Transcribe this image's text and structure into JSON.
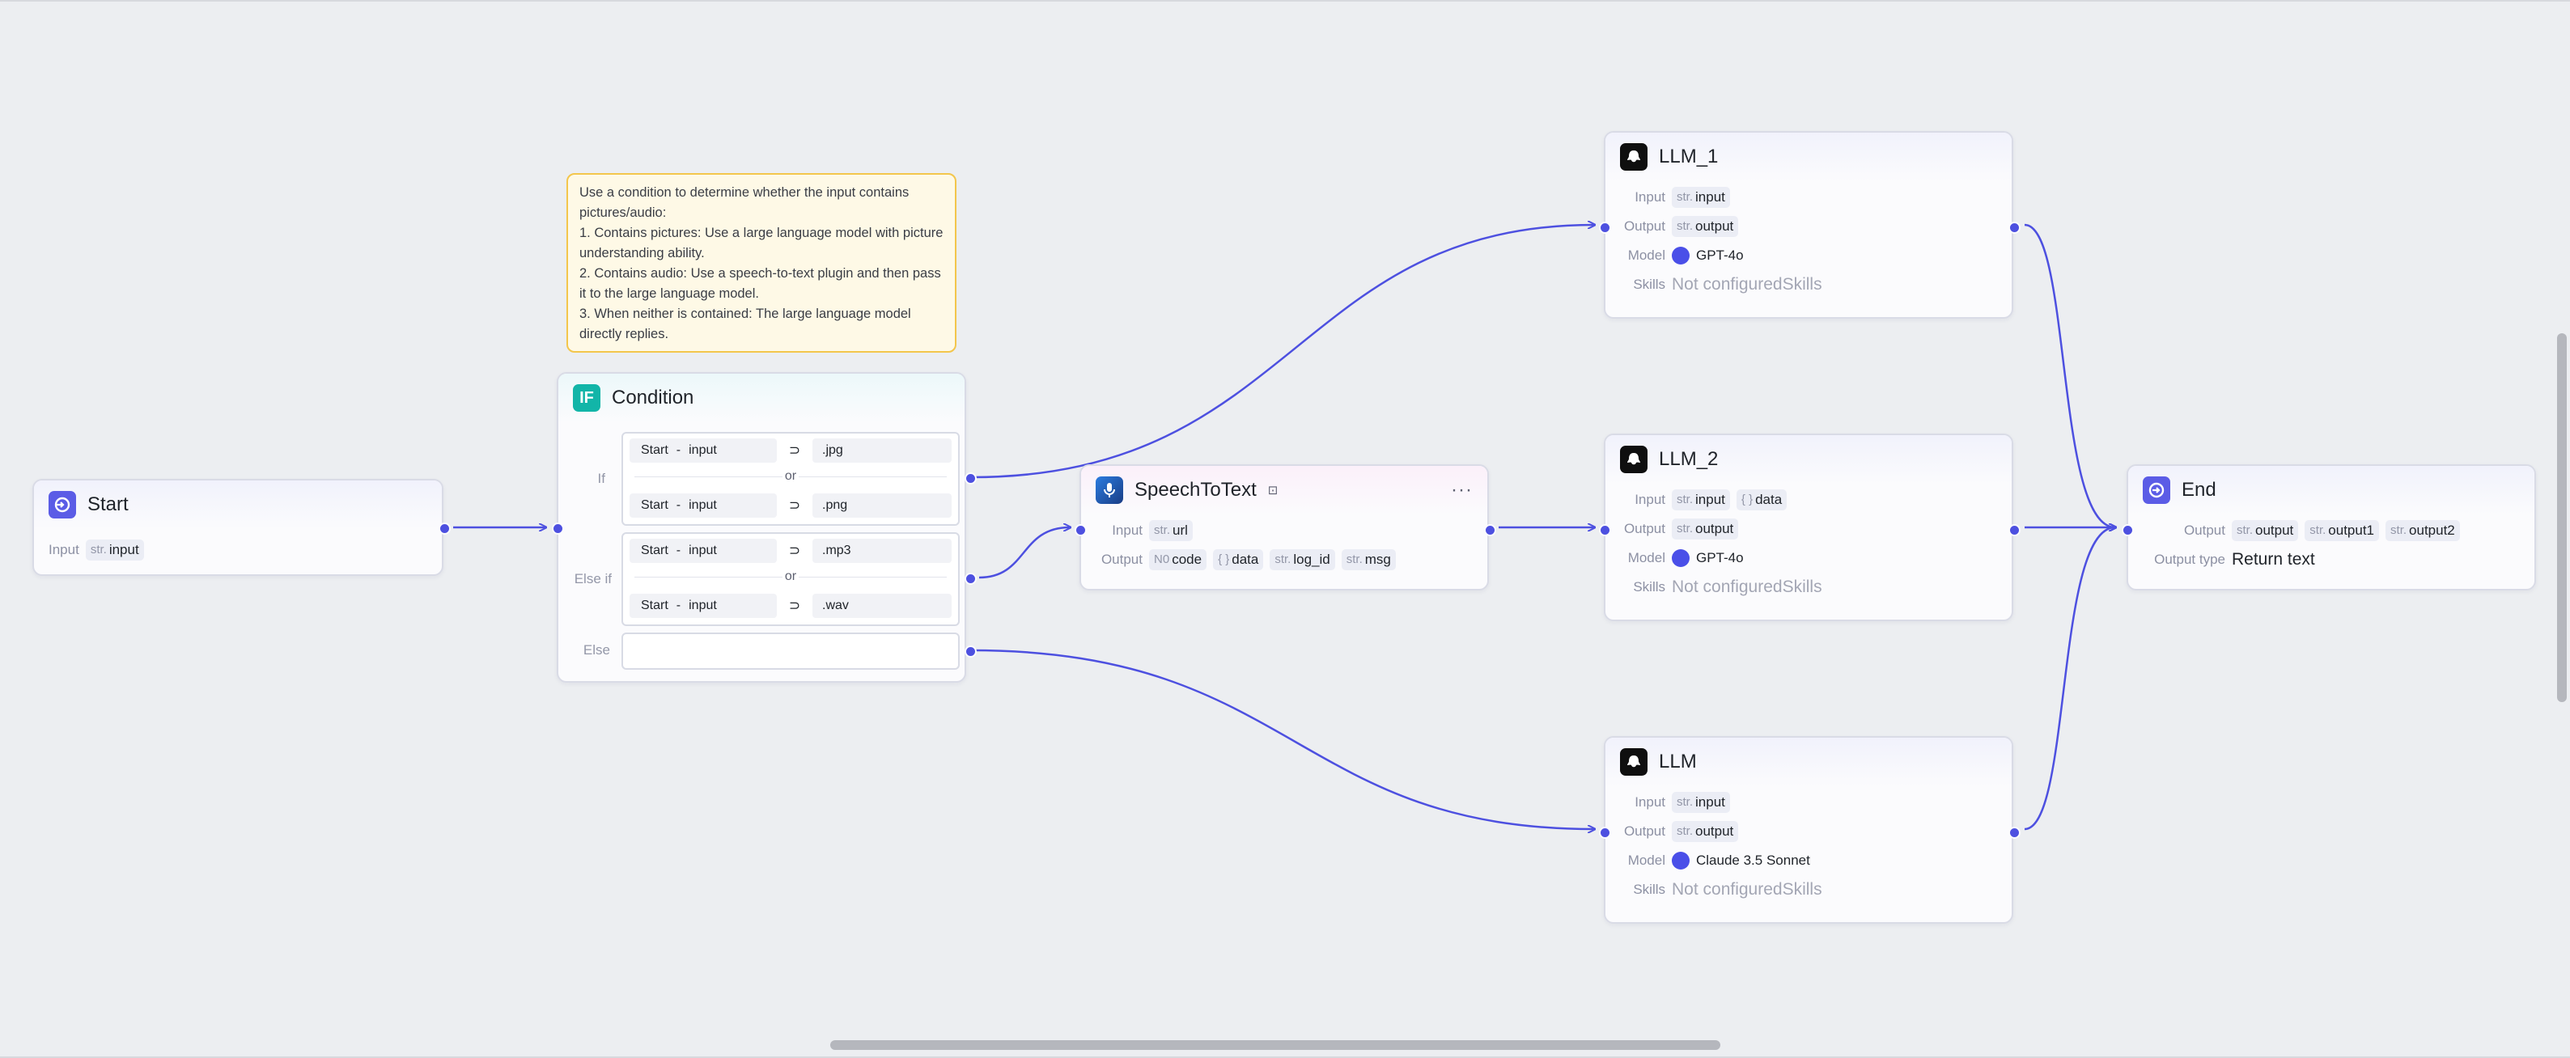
{
  "note": {
    "lines": [
      "Use a condition to determine whether the input contains pictures/audio:",
      "1. Contains pictures: Use a large language model with picture understanding ability.",
      "2. Contains audio: Use a speech-to-text plugin and then pass it to the large language model.",
      "3. When neither is contained: The large language model directly replies."
    ]
  },
  "start": {
    "title": "Start",
    "input_label": "Input",
    "input_type": "str.",
    "input_name": "input"
  },
  "condition": {
    "title": "Condition",
    "icon": "IF",
    "if_label": "If",
    "elseif_label": "Else if",
    "else_label": "Else",
    "or_label": "or",
    "op": "⊃",
    "rows": [
      {
        "src": "Start",
        "sep": "-",
        "var": "input",
        "value": ".jpg"
      },
      {
        "src": "Start",
        "sep": "-",
        "var": "input",
        "value": ".png"
      },
      {
        "src": "Start",
        "sep": "-",
        "var": "input",
        "value": ".mp3"
      },
      {
        "src": "Start",
        "sep": "-",
        "var": "input",
        "value": ".wav"
      }
    ]
  },
  "speech": {
    "title": "SpeechToText",
    "more": "···",
    "input_label": "Input",
    "output_label": "Output",
    "input": {
      "type": "str.",
      "name": "url"
    },
    "outputs": [
      {
        "type": "N0",
        "name": "code"
      },
      {
        "type": "{ }",
        "name": "data"
      },
      {
        "type": "str.",
        "name": "log_id"
      },
      {
        "type": "str.",
        "name": "msg"
      }
    ]
  },
  "llm1": {
    "title": "LLM_1",
    "input_label": "Input",
    "output_label": "Output",
    "model_label": "Model",
    "skills_label": "Skills",
    "inputs": [
      {
        "type": "str.",
        "name": "input"
      }
    ],
    "outputs": [
      {
        "type": "str.",
        "name": "output"
      }
    ],
    "model": "GPT-4o",
    "skills": "Not configuredSkills"
  },
  "llm2": {
    "title": "LLM_2",
    "input_label": "Input",
    "output_label": "Output",
    "model_label": "Model",
    "skills_label": "Skills",
    "inputs": [
      {
        "type": "str.",
        "name": "input"
      },
      {
        "type": "{ }",
        "name": "data"
      }
    ],
    "outputs": [
      {
        "type": "str.",
        "name": "output"
      }
    ],
    "model": "GPT-4o",
    "skills": "Not configuredSkills"
  },
  "llm": {
    "title": "LLM",
    "input_label": "Input",
    "output_label": "Output",
    "model_label": "Model",
    "skills_label": "Skills",
    "inputs": [
      {
        "type": "str.",
        "name": "input"
      }
    ],
    "outputs": [
      {
        "type": "str.",
        "name": "output"
      }
    ],
    "model": "Claude 3.5 Sonnet",
    "skills": "Not configuredSkills"
  },
  "end": {
    "title": "End",
    "output_label": "Output",
    "outputs": [
      {
        "type": "str.",
        "name": "output"
      },
      {
        "type": "str.",
        "name": "output1"
      },
      {
        "type": "str.",
        "name": "output2"
      }
    ],
    "output_type_label": "Output type",
    "output_type": "Return text"
  },
  "colors": {
    "edge": "#4d50e0",
    "canvas": "#eceef1",
    "note_border": "#f3c64c",
    "note_bg": "#fef9e6",
    "model_dot": "#4a4fe8"
  }
}
